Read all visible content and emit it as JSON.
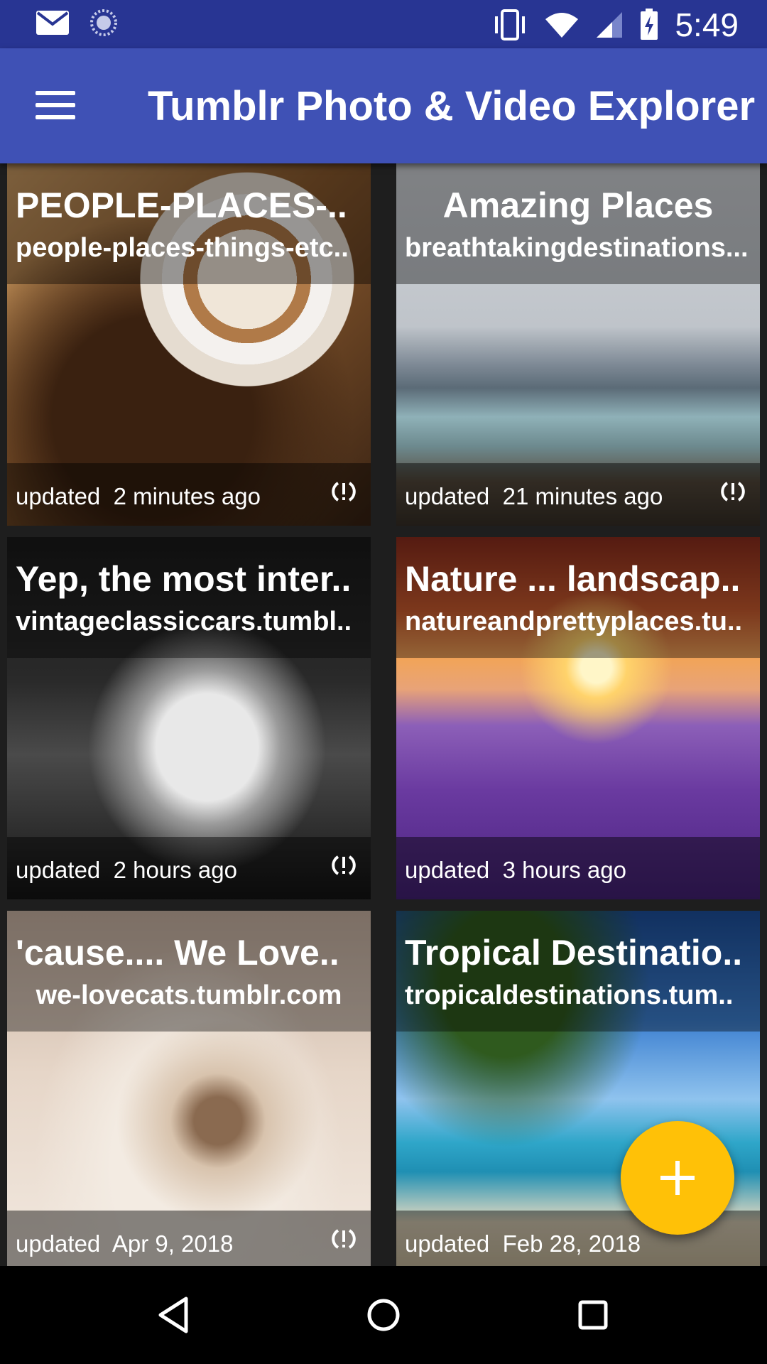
{
  "status_bar": {
    "time": "5:49",
    "icons": [
      "gmail-icon",
      "sync-progress-icon",
      "vibrate-icon",
      "wifi-icon",
      "signal-icon",
      "battery-charging-icon"
    ]
  },
  "app_bar": {
    "title": "Tumblr Photo & Video Explorer",
    "menu_icon": "hamburger-menu-icon"
  },
  "cards": [
    {
      "title": "PEOPLE-PLACES-..",
      "subtitle": "people-places-things-etc..",
      "updated_label": "updated",
      "updated_time": "2 minutes ago",
      "has_sync_icon": true
    },
    {
      "title": "Amazing Places",
      "subtitle": "breathtakingdestinations...",
      "updated_label": "updated",
      "updated_time": "21 minutes ago",
      "has_sync_icon": true
    },
    {
      "title": "Yep, the most inter..",
      "subtitle": "vintageclassiccars.tumbl..",
      "updated_label": "updated",
      "updated_time": "2 hours ago",
      "has_sync_icon": true
    },
    {
      "title": "Nature ... landscap..",
      "subtitle": "natureandprettyplaces.tu..",
      "updated_label": "updated",
      "updated_time": "3 hours ago",
      "has_sync_icon": false
    },
    {
      "title": "'cause.... We Love..",
      "subtitle": "we-lovecats.tumblr.com",
      "updated_label": "updated",
      "updated_time": "Apr 9, 2018",
      "has_sync_icon": true
    },
    {
      "title": "Tropical Destinatio..",
      "subtitle": "tropicaldestinations.tum..",
      "updated_label": "updated",
      "updated_time": "Feb 28, 2018",
      "has_sync_icon": false
    }
  ],
  "fab": {
    "icon": "plus-icon",
    "color": "#ffc107"
  },
  "nav_bar": {
    "buttons": [
      "back-icon",
      "home-icon",
      "recents-icon"
    ]
  },
  "colors": {
    "status_bar": "#283593",
    "app_bar": "#3f51b5",
    "background": "#1e1e1e"
  }
}
